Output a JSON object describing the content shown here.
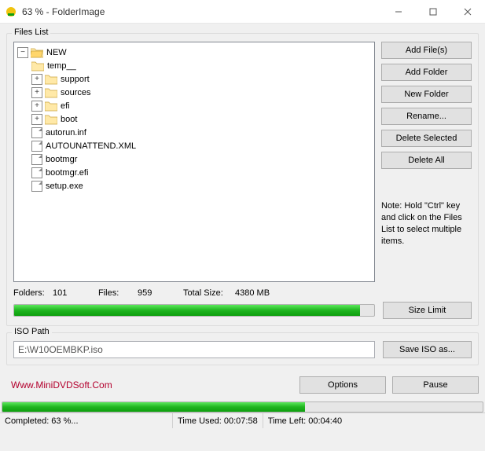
{
  "titlebar": {
    "title": "63 % - FolderImage"
  },
  "files_group_label": "Files List",
  "tree": {
    "root": {
      "name": "NEW",
      "expander": "−"
    },
    "children": [
      {
        "type": "folder",
        "name": "temp__",
        "expander": ""
      },
      {
        "type": "folder",
        "name": "support",
        "expander": "+"
      },
      {
        "type": "folder",
        "name": "sources",
        "expander": "+"
      },
      {
        "type": "folder",
        "name": "efi",
        "expander": "+"
      },
      {
        "type": "folder",
        "name": "boot",
        "expander": "+"
      },
      {
        "type": "file",
        "name": "autorun.inf"
      },
      {
        "type": "file",
        "name": "AUTOUNATTEND.XML"
      },
      {
        "type": "file",
        "name": "bootmgr"
      },
      {
        "type": "file",
        "name": "bootmgr.efi"
      },
      {
        "type": "file",
        "name": "setup.exe"
      }
    ]
  },
  "side_buttons": {
    "add_files": "Add File(s)",
    "add_folder": "Add Folder",
    "new_folder": "New Folder",
    "rename": "Rename...",
    "delete_selected": "Delete Selected",
    "delete_all": "Delete All"
  },
  "note": "Note: Hold \"Ctrl\" key and click on the Files List to select multiple items.",
  "counts": {
    "folders_label": "Folders:",
    "folders_value": "101",
    "files_label": "Files:",
    "files_value": "959",
    "totalsize_label": "Total Size:",
    "totalsize_value": "4380 MB"
  },
  "files_progress_percent": 96,
  "size_limit_label": "Size Limit",
  "iso_group_label": "ISO Path",
  "iso_path": "E:\\W10OEMBKP.iso",
  "save_iso_label": "Save ISO as...",
  "link_text": "Www.MiniDVDSoft.Com",
  "options_label": "Options",
  "pause_label": "Pause",
  "global_progress_percent": 63,
  "status": {
    "completed": "Completed: 63 %...",
    "time_used": "Time Used:  00:07:58",
    "time_left": "Time Left:  00:04:40"
  }
}
